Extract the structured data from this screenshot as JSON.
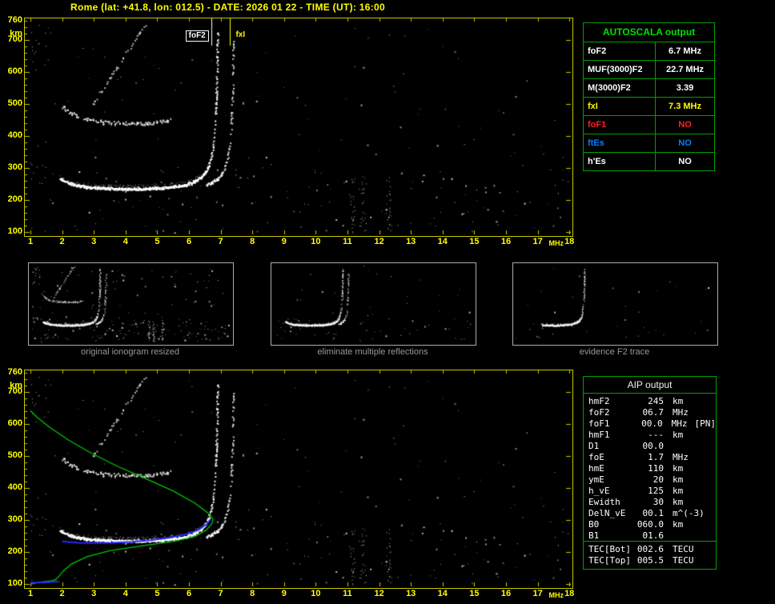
{
  "title": "Rome (lat: +41.8, lon: 012.5) - DATE: 2026 01 22 - TIME (UT): 16:00",
  "colors": {
    "background": "#000000",
    "axis": "#C8C800",
    "tick_text": "#FFFF00",
    "table_border": "#00A000",
    "table_header_green": "#00E000",
    "white": "#FFFFFF",
    "yellow": "#FFFF00",
    "red": "#FF2020",
    "blue": "#0080FF",
    "profile_green": "#00C800",
    "trace_blue": "#2828FF",
    "thumb_label": "#989898"
  },
  "top_plot": {
    "y_unit": "km",
    "y_ticks": [
      "760",
      "700",
      "600",
      "500",
      "400",
      "300",
      "200",
      "100"
    ],
    "x_ticks": [
      "1",
      "2",
      "3",
      "4",
      "5",
      "6",
      "7",
      "8",
      "9",
      "10",
      "11",
      "12",
      "13",
      "14",
      "15",
      "16",
      "17",
      "18"
    ],
    "x_unit": "MHz",
    "markers": [
      {
        "label": "foF2",
        "freq": 6.7,
        "color": "#FFFFFF",
        "boxed": true
      },
      {
        "label": "fxI",
        "freq": 7.3,
        "color": "#FFFF00",
        "boxed": false
      }
    ]
  },
  "bottom_plot": {
    "y_unit": "km",
    "y_ticks": [
      "760",
      "700",
      "600",
      "500",
      "400",
      "300",
      "200",
      "100"
    ],
    "x_ticks": [
      "1",
      "2",
      "3",
      "4",
      "5",
      "6",
      "7",
      "8",
      "9",
      "10",
      "11",
      "12",
      "13",
      "14",
      "15",
      "16",
      "17",
      "18"
    ],
    "x_unit": "MHz"
  },
  "autoscala": {
    "header": "AUTOSCALA output",
    "rows": [
      {
        "param": "foF2",
        "value": "6.7 MHz",
        "color": "#FFFFFF"
      },
      {
        "param": "MUF(3000)F2",
        "value": "22.7 MHz",
        "color": "#FFFFFF"
      },
      {
        "param": "M(3000)F2",
        "value": "3.39",
        "color": "#FFFFFF"
      },
      {
        "param": "fxI",
        "value": "7.3 MHz",
        "color": "#FFFF00"
      },
      {
        "param": "foF1",
        "value": "NO",
        "color": "#FF2020"
      },
      {
        "param": "ftEs",
        "value": "NO",
        "color": "#0080FF"
      },
      {
        "param": "h'Es",
        "value": "NO",
        "color": "#FFFFFF"
      }
    ]
  },
  "thumbnails": [
    {
      "label": "original ionogram resized"
    },
    {
      "label": "eliminate multiple reflections"
    },
    {
      "label": "evidence F2 trace"
    }
  ],
  "aip": {
    "header": "AIP output",
    "rows": [
      {
        "name": "hmF2",
        "value": "245",
        "unit": "km",
        "flag": ""
      },
      {
        "name": "foF2",
        "value": "06.7",
        "unit": "MHz",
        "flag": ""
      },
      {
        "name": "foF1",
        "value": "00.0",
        "unit": "MHz",
        "flag": "[PN]"
      },
      {
        "name": "hmF1",
        "value": "---",
        "unit": "km",
        "flag": ""
      },
      {
        "name": "D1",
        "value": "00.0",
        "unit": "",
        "flag": ""
      },
      {
        "name": "foE",
        "value": "1.7",
        "unit": "MHz",
        "flag": ""
      },
      {
        "name": "hmE",
        "value": "110",
        "unit": "km",
        "flag": ""
      },
      {
        "name": "ymE",
        "value": "20",
        "unit": "km",
        "flag": ""
      },
      {
        "name": "h_vE",
        "value": "125",
        "unit": "km",
        "flag": ""
      },
      {
        "name": "Ewidth",
        "value": "30",
        "unit": "km",
        "flag": ""
      },
      {
        "name": "DelN_vE",
        "value": "00.1",
        "unit": "m^(-3)",
        "flag": ""
      },
      {
        "name": "B0",
        "value": "060.0",
        "unit": "km",
        "flag": ""
      },
      {
        "name": "B1",
        "value": "01.6",
        "unit": "",
        "flag": ""
      }
    ],
    "tec_rows": [
      {
        "name": "TEC[Bot]",
        "value": "002.6",
        "unit": "TECU"
      },
      {
        "name": "TEC[Top]",
        "value": "005.5",
        "unit": "TECU"
      }
    ]
  },
  "profile": {
    "bottomside": [
      [
        1.02,
        100
      ],
      [
        1.2,
        104
      ],
      [
        1.5,
        108
      ],
      [
        1.7,
        111
      ],
      [
        1.8,
        114
      ],
      [
        1.9,
        124
      ],
      [
        2.05,
        142
      ],
      [
        2.3,
        163
      ],
      [
        2.8,
        186
      ],
      [
        3.5,
        204
      ],
      [
        4.5,
        219
      ],
      [
        5.5,
        233
      ],
      [
        6.2,
        249
      ],
      [
        6.55,
        269
      ],
      [
        6.72,
        288
      ],
      [
        6.76,
        302
      ]
    ],
    "topside": [
      [
        6.76,
        302
      ],
      [
        6.6,
        322
      ],
      [
        6.2,
        352
      ],
      [
        5.5,
        391
      ],
      [
        4.6,
        431
      ],
      [
        3.7,
        470
      ],
      [
        2.9,
        510
      ],
      [
        2.2,
        550
      ],
      [
        1.6,
        590
      ],
      [
        1.2,
        622
      ],
      [
        1.0,
        642
      ]
    ],
    "fitted_trace": [
      [
        2.0,
        233
      ],
      [
        2.5,
        229
      ],
      [
        3.0,
        228
      ],
      [
        3.6,
        229
      ],
      [
        4.2,
        232
      ],
      [
        4.8,
        237
      ],
      [
        5.4,
        245
      ],
      [
        5.9,
        255
      ],
      [
        6.3,
        269
      ],
      [
        6.55,
        286
      ],
      [
        6.68,
        302
      ]
    ],
    "fitted_E": [
      [
        1.0,
        104
      ],
      [
        1.45,
        105
      ],
      [
        1.9,
        108
      ]
    ]
  },
  "chart_data": {
    "type": "scatter",
    "description": "Vertical-incidence ionogram: virtual height (km) vs sounding frequency (MHz), shown twice (raw with AUTOSCALA markers, and with AIP fitted profile)",
    "x_range": [
      1,
      18
    ],
    "x_unit": "MHz",
    "y_range": [
      100,
      760
    ],
    "y_unit": "km",
    "scaled_values": {
      "foF2_MHz": 6.7,
      "fxI_MHz": 7.3,
      "MUF3000F2_MHz": 22.7,
      "M3000F2": 3.39,
      "hmF2_km": 245,
      "foE_MHz": 1.7,
      "hmE_km": 110,
      "min_virtual_height_km": 230,
      "TEC_bottom_TECU": 2.6,
      "TEC_top_TECU": 5.5
    }
  }
}
